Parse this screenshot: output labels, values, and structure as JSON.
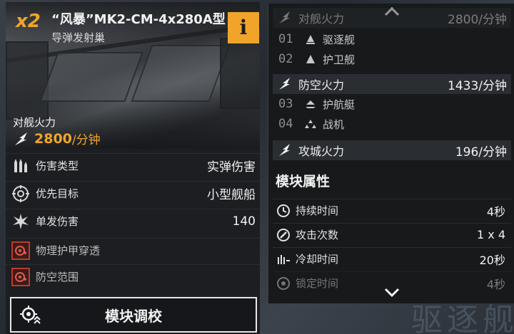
{
  "module": {
    "multiplier": "x2",
    "title": "“风暴”MK2-CM-4x280A型",
    "subtitle": "导弹发射巢",
    "info_label": "i",
    "primary_stat_label": "对舰火力",
    "primary_stat_value": "2800",
    "primary_stat_unit": "/分钟"
  },
  "stats": [
    {
      "label": "伤害类型",
      "value": "实弹伤害",
      "icon": "ammo-icon"
    },
    {
      "label": "优先目标",
      "value": "小型舰船",
      "icon": "crosshair-icon"
    },
    {
      "label": "单发伤害",
      "value": "140",
      "icon": "burst-icon"
    },
    {
      "label": "物理护甲穿透",
      "value": "",
      "icon": "armor-penetration-icon"
    },
    {
      "label": "防空范围",
      "value": "",
      "icon": "air-defense-range-icon"
    }
  ],
  "tune_button_label": "模块调校",
  "firepower": {
    "anti_ship": {
      "label": "对舰火力",
      "value": "2800/分钟"
    },
    "anti_ship_targets": [
      {
        "index": "01",
        "label": "驱逐舰",
        "icon": "destroyer-icon"
      },
      {
        "index": "02",
        "label": "护卫舰",
        "icon": "frigate-icon"
      }
    ],
    "anti_air": {
      "label": "防空火力",
      "value": "1433/分钟"
    },
    "anti_air_targets": [
      {
        "index": "03",
        "label": "护航艇",
        "icon": "escort-icon"
      },
      {
        "index": "04",
        "label": "战机",
        "icon": "fighter-icon"
      }
    ],
    "siege": {
      "label": "攻城火力",
      "value": "196/分钟"
    }
  },
  "attributes": {
    "title": "模块属性",
    "items": [
      {
        "label": "持续时间",
        "value": "4秒",
        "icon": "clock-icon"
      },
      {
        "label": "攻击次数",
        "value": "1 x 4",
        "icon": "attack-count-icon"
      },
      {
        "label": "冷却时间",
        "value": "20秒",
        "icon": "cooldown-icon"
      },
      {
        "label": "锁定时间",
        "value": "4秒",
        "icon": "lock-time-icon"
      }
    ]
  },
  "background_text": "驱逐舰",
  "colors": {
    "accent": "#f0a52a",
    "panel": "#1c1e21",
    "danger": "#c0392b"
  }
}
